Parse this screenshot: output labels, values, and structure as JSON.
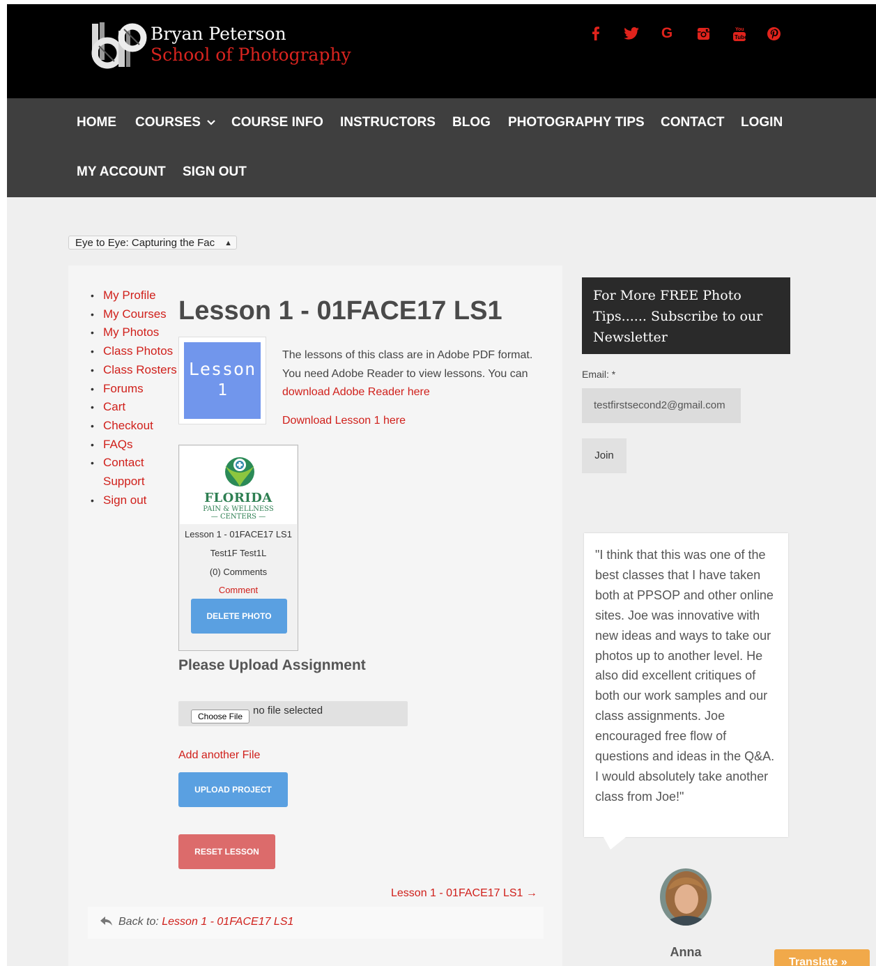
{
  "brand": {
    "line1": "Bryan Peterson",
    "line2": "School of Photography",
    "accent": "#d8241f"
  },
  "social": {
    "icons": [
      "facebook-icon",
      "twitter-icon",
      "google-icon",
      "instagram-icon",
      "youtube-icon",
      "pinterest-icon"
    ]
  },
  "nav": {
    "home": "HOME",
    "courses": "COURSES",
    "course_info": "COURSE INFO",
    "instructors": "INSTRUCTORS",
    "blog": "BLOG",
    "photography_tips": "PHOTOGRAPHY TIPS",
    "contact": "CONTACT",
    "login": "LOGIN",
    "my_account": "MY ACCOUNT",
    "sign_out": "SIGN OUT"
  },
  "course_select": {
    "value": "Eye to Eye: Capturing the Fac"
  },
  "sidebar": {
    "items": [
      {
        "label": "My Profile"
      },
      {
        "label": "My Courses"
      },
      {
        "label": "My Photos"
      },
      {
        "label": "Class Photos"
      },
      {
        "label": "Class Rosters"
      },
      {
        "label": "Forums"
      },
      {
        "label": "Cart"
      },
      {
        "label": "Checkout"
      },
      {
        "label": "FAQs"
      },
      {
        "label": "Contact Support"
      },
      {
        "label": "Sign out"
      }
    ]
  },
  "lesson": {
    "title": "Lesson 1 - 01FACE17 LS1",
    "thumb_line1": "Lesson",
    "thumb_line2": "1",
    "intro": "The lessons of this class are in Adobe PDF format. You need Adobe Reader to view lessons. You can ",
    "reader_link": "download Adobe Reader here",
    "download_link": "Download Lesson 1 here"
  },
  "photo_card": {
    "logo_main": "FLORIDA",
    "logo_sub1": "PAIN & WELLNESS",
    "logo_sub2": "— CENTERS —",
    "caption": "Lesson 1 - 01FACE17 LS1",
    "author": "Test1F Test1L",
    "comments": "(0) Comments",
    "comment_link": "Comment",
    "delete_label": "DELETE PHOTO"
  },
  "upload": {
    "heading": "Please Upload Assignment",
    "choose_label": "Choose File",
    "no_file": "no file selected",
    "add_file": "Add another File",
    "upload_label": "UPLOAD PROJECT",
    "reset_label": "RESET LESSON"
  },
  "pager": {
    "next": "Lesson 1 - 01FACE17 LS1 →",
    "back_label": "Back to: ",
    "back_link": "Lesson 1 - 01FACE17 LS1"
  },
  "newsletter": {
    "heading": "For More FREE Photo Tips...... Subscribe to our Newsletter",
    "email_label": "Email: *",
    "email_value": "testfirstsecond2@gmail.com",
    "join_label": "Join"
  },
  "testimonial": {
    "quote": "\"I think that this was one of the best classes that I have taken both at PPSOP and other online sites. Joe was innovative with new ideas and ways to take our photos up to another level. He also did excellent critiques of both our work samples and our class assignments. Joe encouraged free flow of questions and ideas in the Q&A. I would absolutely take another class from Joe!\"",
    "author": "Anna"
  },
  "translate": {
    "label": "Translate »"
  }
}
